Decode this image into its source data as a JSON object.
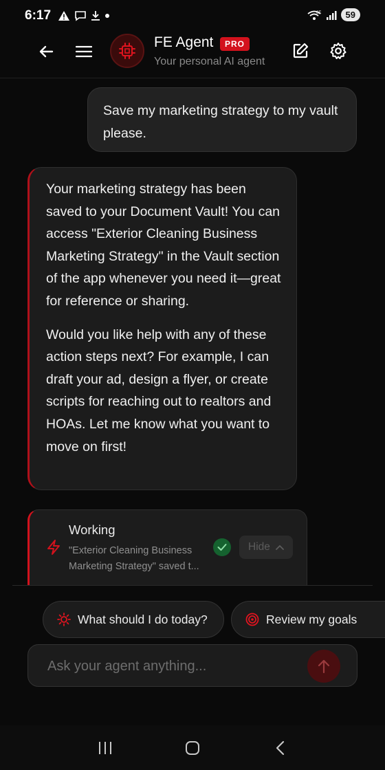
{
  "status_bar": {
    "time": "6:17",
    "network": "6E",
    "battery": "59"
  },
  "header": {
    "agent_name": "FE Agent",
    "badge": "PRO",
    "subtitle": "Your personal AI agent"
  },
  "messages": {
    "user": "Save my marketing strategy to my vault please.",
    "agent_paragraph_1": "Your marketing strategy has been saved to your Document Vault! You can access \"Exterior Cleaning Business Marketing Strategy\" in the Vault section of the app whenever you need it—great for reference or sharing.",
    "agent_paragraph_2": "Would you like help with any of these action steps next? For example, I can draft your ad, design a flyer, or create scripts for reaching out to realtors and HOAs. Let me know what you want to move on first!"
  },
  "working_card": {
    "title": "Working",
    "description": "\"Exterior Cleaning Business Marketing Strategy\" saved t...",
    "hide_label": "Hide"
  },
  "suggestions": [
    {
      "label": "What should I do today?",
      "icon": "sun-icon"
    },
    {
      "label": "Review my goals",
      "icon": "target-icon"
    }
  ],
  "composer": {
    "placeholder": "Ask your agent anything..."
  },
  "colors": {
    "accent": "#d3121d",
    "success": "#15622f",
    "background": "#0a0a0a"
  }
}
